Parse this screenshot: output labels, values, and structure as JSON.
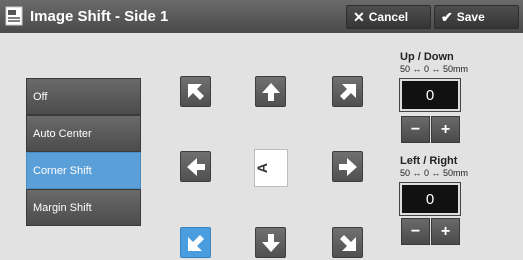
{
  "header": {
    "title": "Image Shift - Side 1",
    "cancel_label": "Cancel",
    "save_label": "Save"
  },
  "options": [
    {
      "label": "Off",
      "selected": false
    },
    {
      "label": "Auto Center",
      "selected": false
    },
    {
      "label": "Corner Shift",
      "selected": true
    },
    {
      "label": "Margin Shift",
      "selected": false
    }
  ],
  "direction_pad": {
    "selected": "down-left",
    "paper_glyph": "A"
  },
  "up_down": {
    "label": "Up / Down",
    "range": "50 ↔ 0 ↔ 50mm",
    "value": "0",
    "minus": "−",
    "plus": "+"
  },
  "left_right": {
    "label": "Left / Right",
    "range": "50 ↔ 0 ↔ 50mm",
    "value": "0",
    "minus": "−",
    "plus": "+"
  },
  "colors": {
    "selected": "#5b9fd8",
    "button": "#5a5a5a"
  }
}
